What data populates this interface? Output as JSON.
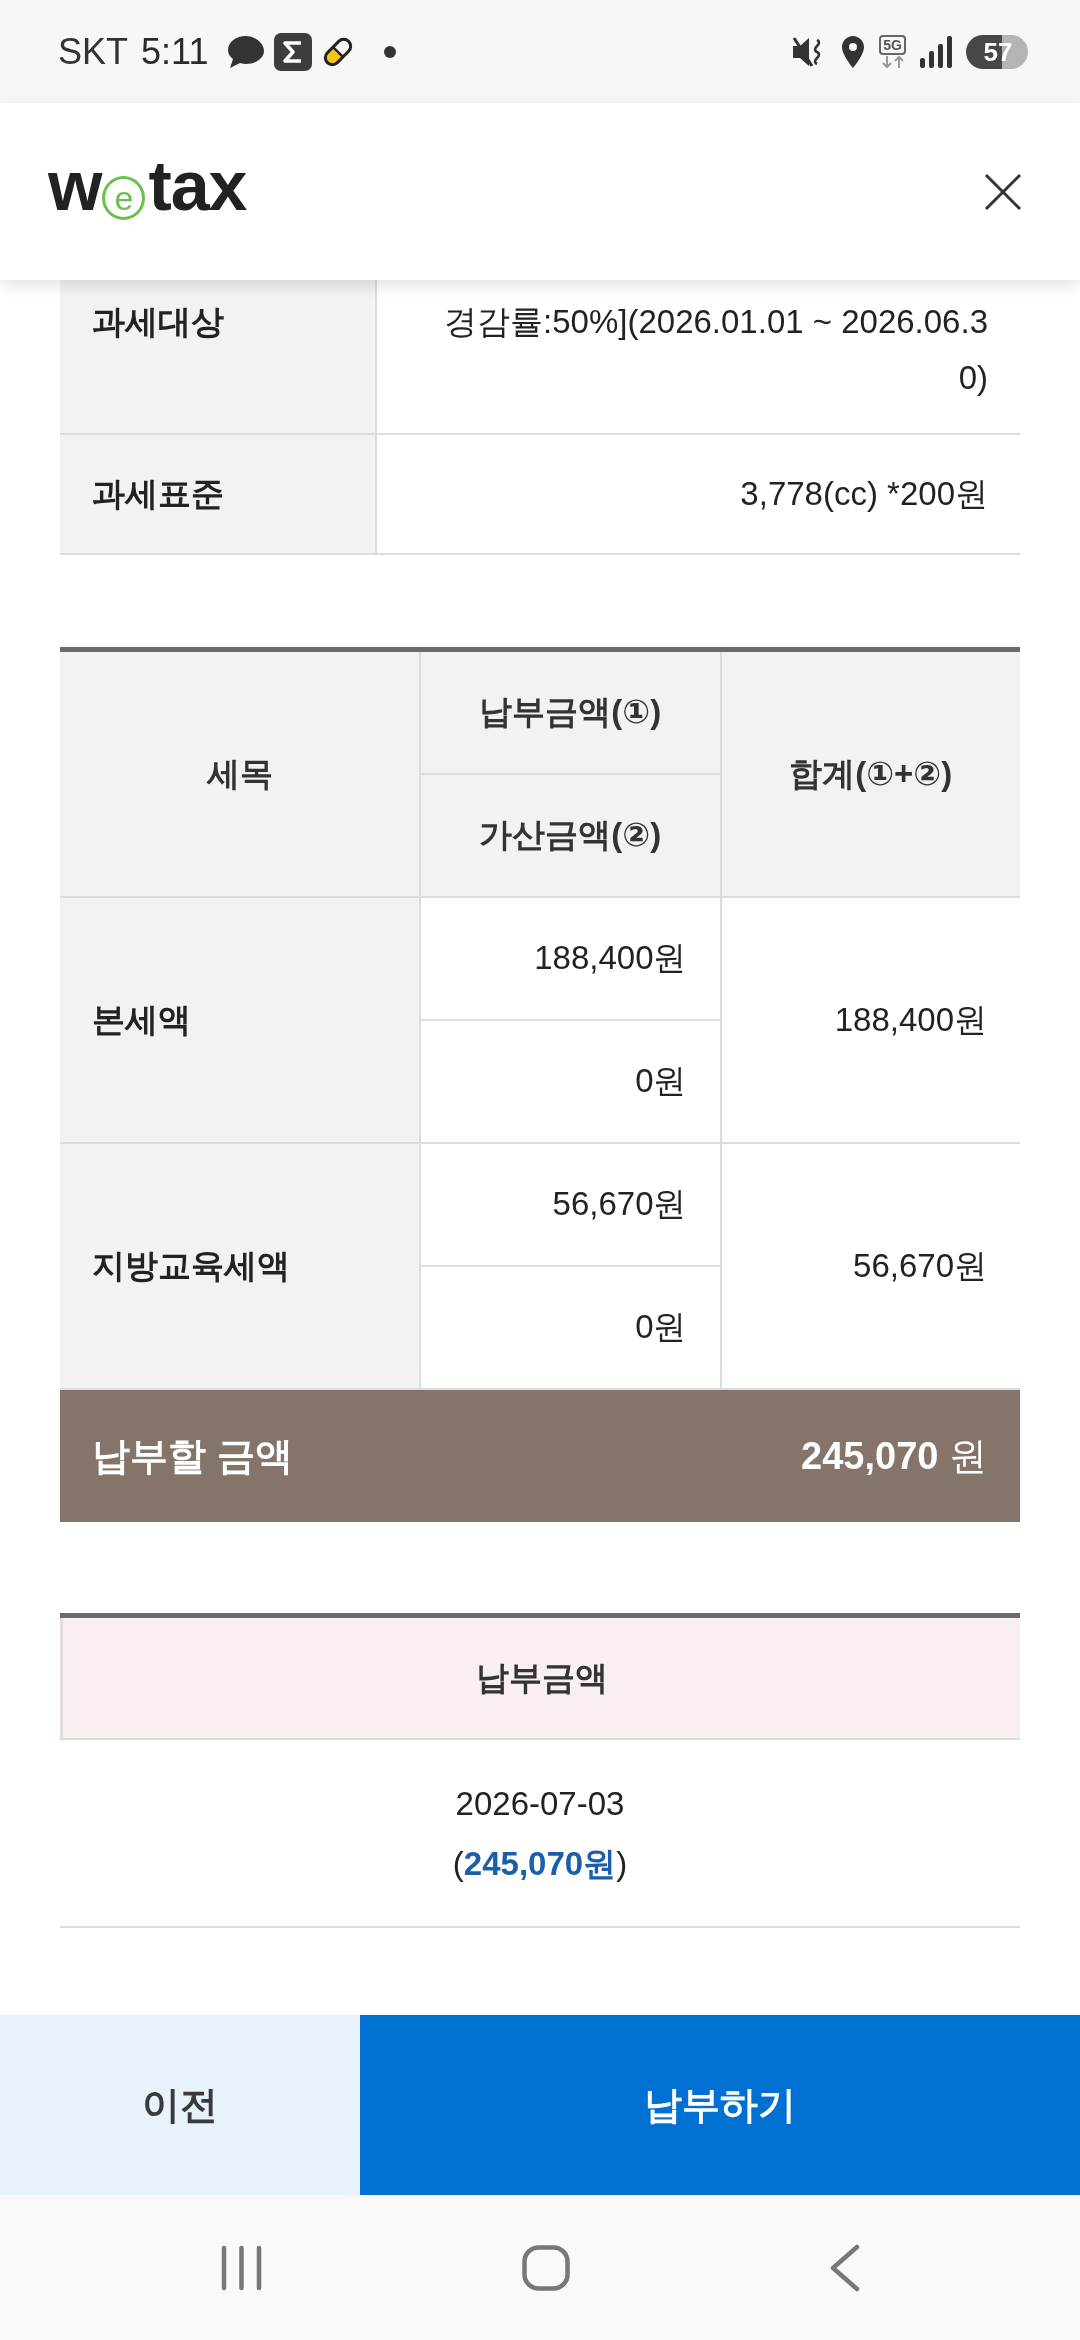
{
  "status_bar": {
    "carrier": "SKT",
    "time": "5:11",
    "network": "5G",
    "battery": "57"
  },
  "header": {
    "logo": [
      {
        "text": "w",
        "kind": "plain"
      },
      {
        "text": "e",
        "kind": "ring"
      },
      {
        "text": "tax",
        "kind": "plain"
      }
    ]
  },
  "info_table": {
    "rows": [
      {
        "label": "과세대상",
        "lines": [
          "경감률:50%](2026.01.01 ~ 2026.06.3",
          "0)"
        ]
      },
      {
        "label": "과세표준",
        "lines": [
          "3,778(cc) *200원"
        ]
      }
    ]
  },
  "tax_table": {
    "columns": {
      "item": "세목",
      "payment": "납부금액(①)",
      "surcharge": "가산금액(②)",
      "total": "합계(①+②)"
    },
    "rows": [
      {
        "item": "본세액",
        "payment": "188,400원",
        "surcharge": "0원",
        "total": "188,400원"
      },
      {
        "item": "지방교육세액",
        "payment": "56,670원",
        "surcharge": "0원",
        "total": "56,670원"
      }
    ],
    "amount_due": {
      "label": "납부할 금액",
      "value": "**245,070** 원"
    }
  },
  "payment_table": {
    "heading": "납부금액",
    "date": "2026-07-03",
    "amount": "(**245,070원**)"
  },
  "buttons": [
    {
      "label": "이전",
      "kind": "secondary"
    },
    {
      "label": "납부하기",
      "kind": "primary"
    }
  ]
}
